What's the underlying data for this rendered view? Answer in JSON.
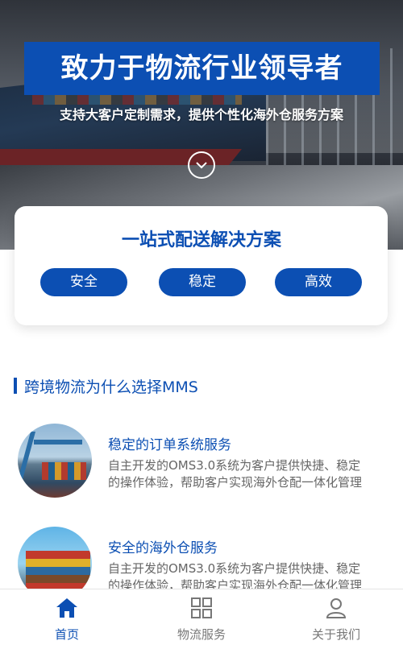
{
  "hero": {
    "title": "致力于物流行业领导者",
    "subtitle": "支持大客户定制需求，提供个性化海外仓服务方案",
    "scroll_icon": "chevron-down-circle-icon"
  },
  "solution": {
    "title": "一站式配送解决方案",
    "pills": [
      "安全",
      "稳定",
      "高效"
    ]
  },
  "why": {
    "title": "跨境物流为什么选择MMS",
    "features": [
      {
        "title": "稳定的订单系统服务",
        "desc_line1": "自主开发的OMS3.0系统为客户提供快捷、稳定",
        "desc_line2": "的操作体验，帮助客户实现海外仓配一体化管理"
      },
      {
        "title": "安全的海外仓服务",
        "desc_line1": "自主开发的OMS3.0系统为客户提供快捷、稳定",
        "desc_line2": "的操作体验，帮助客户实现海外仓配一体化管理"
      }
    ]
  },
  "tabbar": {
    "tabs": [
      {
        "label": "首页",
        "icon": "home-icon",
        "active": true
      },
      {
        "label": "物流服务",
        "icon": "grid-icon",
        "active": false
      },
      {
        "label": "关于我们",
        "icon": "user-icon",
        "active": false
      }
    ]
  },
  "colors": {
    "brand": "#0c4fb3",
    "text_muted": "#666666",
    "tab_inactive": "#777777"
  }
}
